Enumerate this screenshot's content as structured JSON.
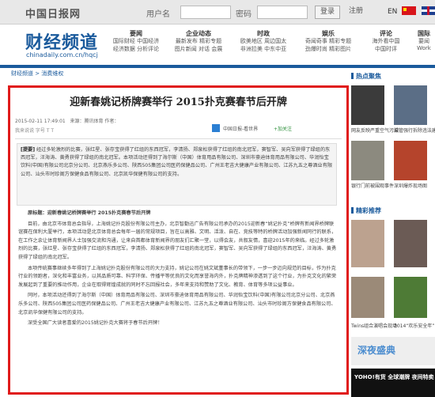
{
  "topbar": {
    "logo": "中国日报网",
    "username_label": "用户名",
    "password_label": "密码",
    "login": "登录",
    "register": "注册",
    "lang_en": "EN"
  },
  "header": {
    "section_title": "财经频道",
    "section_url": "chinadaily.com.cn/hqcj",
    "nav": [
      {
        "title": "要闻",
        "rows": [
          "国际财经 中国经济",
          "经济数据 分析评论"
        ]
      },
      {
        "title": "企业动态",
        "rows": [
          "最新发布 精彩专题",
          "图片新闻 对话 会展"
        ]
      },
      {
        "title": "时政",
        "rows": [
          "欧美地区 周边国太",
          "非洲拉美 中东中亚"
        ]
      },
      {
        "title": "娱乐",
        "rows": [
          "奇闻奇事 精彩专题",
          "劲爆时尚 精彩图片"
        ]
      },
      {
        "title": "评论",
        "rows": [
          "海外看中国",
          "中国时评"
        ]
      },
      {
        "title": "国际",
        "rows": [
          "要闻",
          "Work"
        ]
      }
    ]
  },
  "breadcrumb": "财经频道 > 消费维权",
  "article": {
    "title": "迎新春姚记桥牌赛举行  2015扑克赛春节后开牌",
    "date": "2015-02-11 17:49:01",
    "meta_extra": "来源：腾讯体育  作者：",
    "tools": "我来说说    字号 T  T",
    "share_source": "中国日报-看世界",
    "share_follow": "+加关注",
    "summary_label": "[提要]",
    "summary": "经过多轮激烈的比赛，张红星、张存宝获得了红组的东西冠军，李清扬、郑泉松获得了红组的南北冠军，窦智军、吴向军获得了绿组的东西冠军，汪海涛、黄勇获得了绿组的南北冠军。本项活动还得到了海尔斯（中国）体育用品有限公司、深圳市豪迪体育用品有限公司、华润怡宝饮料(中国)有限公司北京分公司、北京燕乐多公司、陕西505集团公司医药保健品公司、广州王老吉大健康产业有限公司、江苏九五之尊酒业有限公司、汕头市时珍阁方保健食品有限公司、北京凯华保健有限公司的支持。",
    "caption": "原标题：迎新春姚记桥牌赛举行  2015扑克赛春节后开牌",
    "paragraphs": [
      "目前，由北京市体育总会指导，上海姚记扑克股份有限公司主办，北京智勤迅广告有限公司承办的2015迎新春“姚记扑克”桥牌有新闻界桥牌联谊赛在保利大厦举行，本项活动是北京体育总会每年一届的常规项目，旨在以高雅、文明、活泼、自在、竞技等特的桥牌活动加强新闻同行的联系，在工作之余让体育新闻界人士加强交流和沟通，让来自首都体育新闻界的朋友们汇聚一堂，以得会友，共叙友情，喜迎2015年的来临。经过多轮激烈的比赛，张红星、张存宝获得了红组的东西冠军，李清扬、郑泉松获得了红组的南北冠军，窦智军、吴向军获得了绿组的东西冠军，汪海涛、黄勇获得了绿组的南北冠军。",
      "本项传统赛事继续多年得到了上海姚记扑克股份有限公司的大力支持，姚记公司在姚文斌董事长的带领下，一步一步迈向规范的目标，作为扑克行业的领跑者，深化和丰富业务，以其品质可靠、科学环保、传播平等优良的文化而享誉海内外，扑克牌精神渗透到了这个行业，为扑克文化的繁荣发展起到了重要的推动作用，企业在取得辉煌成就的同时不忘回报社会，多年来支持和赞助了文化、教育、体育等多项公益事业。",
      "同时，本项活动还得到了海尔斯（中国）体育用品有限公司、深圳市豪迪体育用品有限公司、华润怡宝饮料(中国)有限公司北京分公司、北京燕乐多公司、陕西505集团公司医药保健品公司、广州王老吉大健康产业有限公司、江苏九五之尊酒业有限公司、汕头市时珍阁方保健食品有限公司、北京凯华保健有限公司的支持。",
      "深受全国广大读者喜爱的2015姚记扑克大赛将于春节后开牌！"
    ]
  },
  "sidebar": {
    "hot_title": "热点聚焦",
    "hot": [
      {
        "caption": "网友反映严重空气污染"
      },
      {
        "caption": "城管强行拆除违法建筑"
      },
      {
        "caption": "银行门前被围观事件"
      },
      {
        "caption": "深圳爆炸现场图"
      }
    ],
    "gallery_title": "精彩推荐",
    "gallery": [
      {
        "caption": ""
      },
      {
        "caption": ""
      },
      {
        "caption": "Twins组合演唱会现场"
      },
      {
        "caption": "2014“欢乐安全年”"
      }
    ],
    "ad1_text": "深夜盛典",
    "ad2_text": "YOHO!有货  全球潮牌  夜间特卖"
  }
}
